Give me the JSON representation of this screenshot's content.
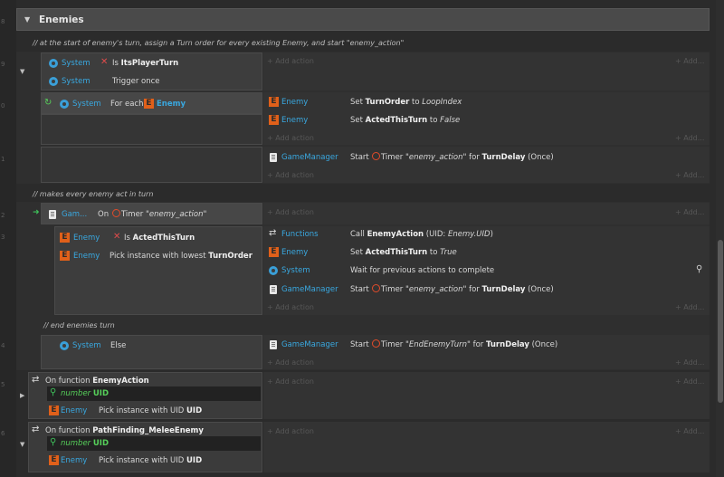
{
  "gutter": {
    "numbers": [
      "8",
      "9",
      "0",
      "1",
      "2",
      "3",
      "4",
      "5",
      "6"
    ]
  },
  "group": {
    "title": "Enemies"
  },
  "comments": {
    "c1": "//  at the start of enemy's turn, assign a Turn order for every existing Enemy, and start \"enemy_action\"",
    "c2": "//  makes every enemy act in turn",
    "c3": "//  end enemies turn"
  },
  "labels": {
    "add_action": "+ Add action",
    "add_more": "+ Add..."
  },
  "event1": {
    "cond1": {
      "object": "System",
      "text_pre": "Is ",
      "text_bold": "ItsPlayerTurn"
    },
    "cond2": {
      "object": "System",
      "text": "Trigger once"
    },
    "sub": {
      "object": "System",
      "text": "For each",
      "target": "Enemy",
      "act1": {
        "object": "Enemy",
        "pre": "Set ",
        "bold": "TurnOrder",
        "mid": " to ",
        "ital": "LoopIndex"
      },
      "act2": {
        "object": "Enemy",
        "pre": "Set ",
        "bold": "ActedThisTurn",
        "mid": " to ",
        "ital": "False"
      }
    },
    "act3": {
      "object": "GameManager",
      "pre": "Start ",
      "mid": " Timer ",
      "ital": "\"enemy_action\"",
      "for": " for ",
      "bold": "TurnDelay",
      "post": " (Once)"
    }
  },
  "event2": {
    "trigger": {
      "object": "Gam...",
      "pre": "On ",
      "mid": " Timer ",
      "ital": "\"enemy_action\""
    },
    "sub": {
      "cond1": {
        "object": "Enemy",
        "pre": "Is ",
        "bold": "ActedThisTurn"
      },
      "cond2": {
        "object": "Enemy",
        "text_pre": "Pick instance with lowest ",
        "text_bold": "TurnOrder"
      },
      "act1": {
        "object": "Functions",
        "pre": "Call ",
        "bold": "EnemyAction",
        "post_pre": " (UID: ",
        "ital": "Enemy.UID",
        "post": ")"
      },
      "act2": {
        "object": "Enemy",
        "pre": "Set ",
        "bold": "ActedThisTurn",
        "mid": " to ",
        "ital": "True"
      },
      "act3": {
        "object": "System",
        "text": "Wait for previous actions to complete"
      },
      "act4": {
        "object": "GameManager",
        "pre": "Start ",
        "mid": " Timer ",
        "ital": "\"enemy_action\"",
        "for": " for ",
        "bold": "TurnDelay",
        "post": " (Once)"
      }
    }
  },
  "event3": {
    "cond": {
      "object": "System",
      "text": "Else"
    },
    "act": {
      "object": "GameManager",
      "pre": "Start ",
      "mid": " Timer ",
      "ital": "\"EndEnemyTurn\"",
      "for": " for ",
      "bold": "TurnDelay",
      "post": " (Once)"
    }
  },
  "function1": {
    "pre": "On function ",
    "name": "EnemyAction",
    "param_type": "number",
    "param_name": "UID",
    "cond": {
      "object": "Enemy",
      "pre": "Pick instance with UID ",
      "bold": "UID"
    }
  },
  "function2": {
    "pre": "On function ",
    "name": "PathFinding_MeleeEnemy",
    "param_type": "number",
    "param_name": "UID",
    "cond": {
      "object": "Enemy",
      "pre": "Pick instance with UID ",
      "bold": "UID"
    }
  },
  "colors": {
    "object_blue": "#39a8e0",
    "accent_orange": "#e0601a",
    "param_green": "#56d05a",
    "cross_red": "#e04b4b"
  }
}
